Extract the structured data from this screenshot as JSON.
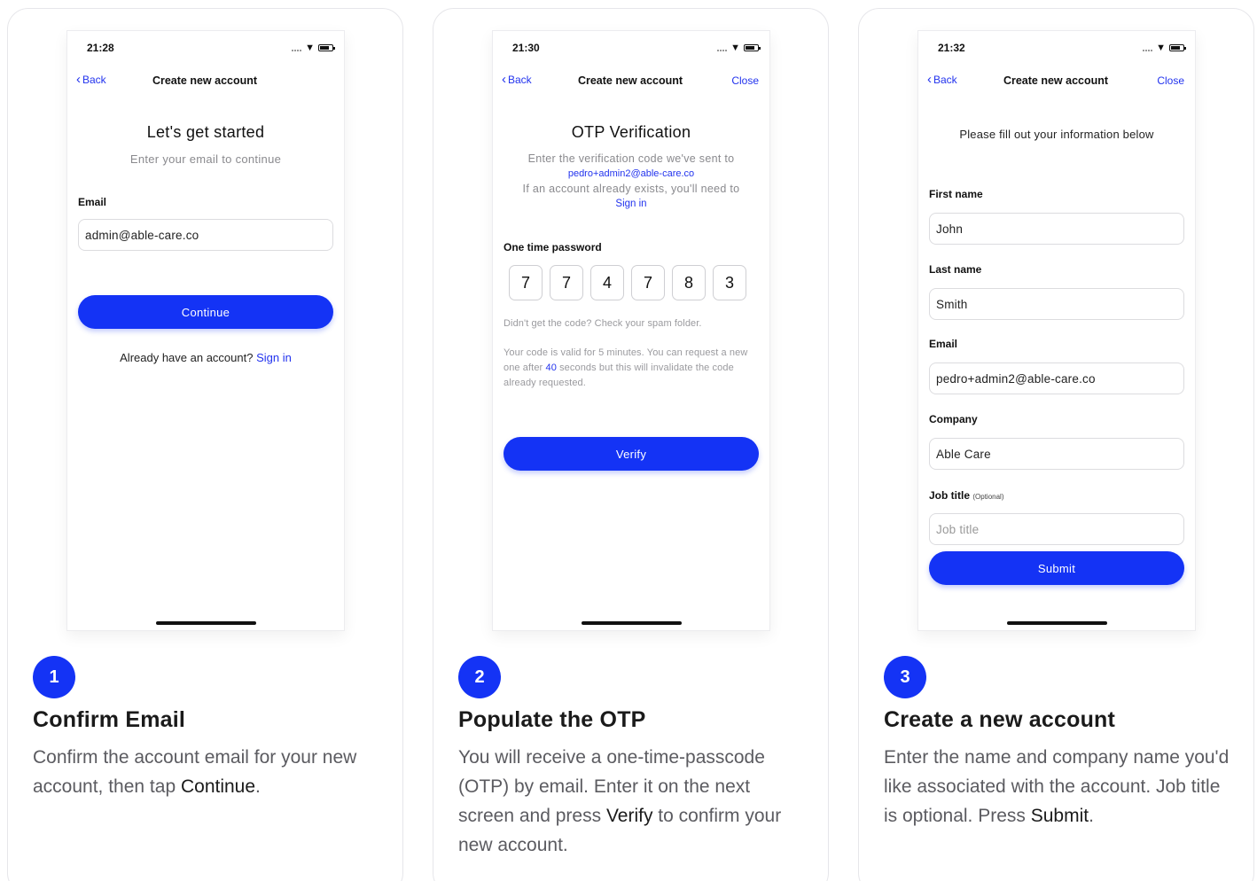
{
  "colors": {
    "accent": "#1433f5",
    "link": "#2233ee",
    "text": "#1a1a1a",
    "muted": "#5b5b60"
  },
  "panel1": {
    "phone": {
      "time": "21:28",
      "nav": {
        "back": "Back",
        "title": "Create new account"
      },
      "heading": "Let's get started",
      "subheading": "Enter your email to continue",
      "email_label": "Email",
      "email_value": "admin@able-care.co",
      "continue_button": "Continue",
      "signin_prompt": "Already have an account?",
      "signin_link": "Sign in"
    },
    "step_number": "1",
    "title": "Confirm Email",
    "description_before": "Confirm the account email for your new account, then tap ",
    "description_emphasis": "Continue",
    "description_after": "."
  },
  "panel2": {
    "phone": {
      "time": "21:30",
      "nav": {
        "back": "Back",
        "title": "Create new account",
        "close": "Close"
      },
      "heading": "OTP Verification",
      "line1": "Enter the verification code we've sent to",
      "email": "pedro+admin2@able-care.co",
      "line2": "If an account already exists, you'll need to",
      "signin_link": "Sign in",
      "otp_label": "One time password",
      "otp_digits": [
        "7",
        "7",
        "4",
        "7",
        "8",
        "3"
      ],
      "spam_note": "Didn't get the code? Check your spam folder.",
      "validity_before": "Your code is valid for 5 minutes.  You can request a new one after ",
      "validity_seconds": "40",
      "validity_after": " seconds but this will invalidate the code already requested.",
      "verify_button": "Verify"
    },
    "step_number": "2",
    "title": "Populate the OTP",
    "description_before": "You will receive a one-time-passcode (OTP) by email. Enter it on the next screen and press ",
    "description_emphasis": "Verify",
    "description_after": " to confirm your new account."
  },
  "panel3": {
    "phone": {
      "time": "21:32",
      "nav": {
        "back": "Back",
        "title": "Create new account",
        "close": "Close"
      },
      "instruction": "Please fill out your information below",
      "first_name_label": "First name",
      "first_name_value": "John",
      "last_name_label": "Last name",
      "last_name_value": "Smith",
      "email_label": "Email",
      "email_value": "pedro+admin2@able-care.co",
      "company_label": "Company",
      "company_value": "Able Care",
      "job_title_label": "Job title",
      "job_title_optional": "(Optional)",
      "job_title_placeholder": "Job title",
      "submit_button": "Submit"
    },
    "step_number": "3",
    "title": "Create a new account",
    "description_before": "Enter the name and company name you'd like associated with the account. Job title is optional. Press ",
    "description_emphasis": "Submit",
    "description_after": "."
  }
}
